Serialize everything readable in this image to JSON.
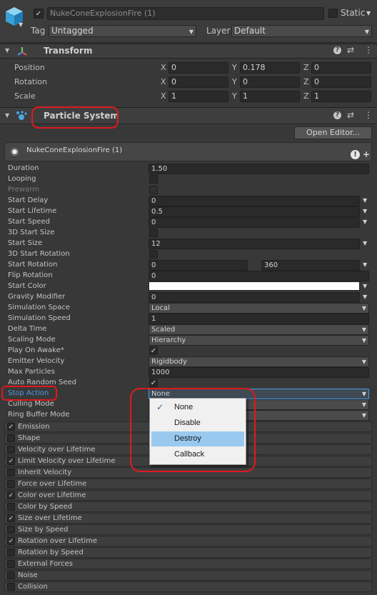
{
  "header": {
    "object_name": "NukeConeExplosionFire (1)",
    "static_label": "Static",
    "tag_label": "Tag",
    "tag_value": "Untagged",
    "layer_label": "Layer",
    "layer_value": "Default"
  },
  "transform": {
    "title": "Transform",
    "rows": [
      {
        "label": "Position",
        "x": "0",
        "y": "0.178",
        "z": "0"
      },
      {
        "label": "Rotation",
        "x": "0",
        "y": "0",
        "z": "0"
      },
      {
        "label": "Scale",
        "x": "1",
        "y": "1",
        "z": "1"
      }
    ],
    "axis_x": "X",
    "axis_y": "Y",
    "axis_z": "Z"
  },
  "particle_system": {
    "title": "Particle System",
    "open_editor_label": "Open Editor...",
    "main_module_title": "NukeConeExplosionFire (1)"
  },
  "props": {
    "duration": {
      "label": "Duration",
      "value": "1.50"
    },
    "looping": {
      "label": "Looping"
    },
    "prewarm": {
      "label": "Prewarm"
    },
    "start_delay": {
      "label": "Start Delay",
      "value": "0"
    },
    "start_lifetime": {
      "label": "Start Lifetime",
      "value": "0.5"
    },
    "start_speed": {
      "label": "Start Speed",
      "value": "0"
    },
    "start_size_3d": {
      "label": "3D Start Size"
    },
    "start_size": {
      "label": "Start Size",
      "value": "12"
    },
    "start_rotation_3d": {
      "label": "3D Start Rotation"
    },
    "start_rotation": {
      "label": "Start Rotation",
      "min": "0",
      "max": "360"
    },
    "flip_rotation": {
      "label": "Flip Rotation",
      "value": "0"
    },
    "start_color": {
      "label": "Start Color",
      "color": "#ffffff"
    },
    "gravity_modifier": {
      "label": "Gravity Modifier",
      "value": "0"
    },
    "simulation_space": {
      "label": "Simulation Space",
      "value": "Local"
    },
    "simulation_speed": {
      "label": "Simulation Speed",
      "value": "1"
    },
    "delta_time": {
      "label": "Delta Time",
      "value": "Scaled"
    },
    "scaling_mode": {
      "label": "Scaling Mode",
      "value": "Hierarchy"
    },
    "play_on_awake": {
      "label": "Play On Awake*"
    },
    "emitter_velocity": {
      "label": "Emitter Velocity",
      "value": "Rigidbody"
    },
    "max_particles": {
      "label": "Max Particles",
      "value": "1000"
    },
    "auto_random_seed": {
      "label": "Auto Random Seed"
    },
    "stop_action": {
      "label": "Stop Action",
      "value": "None"
    },
    "culling_mode": {
      "label": "Culling Mode"
    },
    "ring_buffer_mode": {
      "label": "Ring Buffer Mode"
    }
  },
  "stop_action_menu": {
    "options": [
      "None",
      "Disable",
      "Destroy",
      "Callback"
    ],
    "selected": "None",
    "highlighted": "Destroy"
  },
  "modules": [
    {
      "label": "Emission",
      "enabled": true
    },
    {
      "label": "Shape",
      "enabled": false
    },
    {
      "label": "Velocity over Lifetime",
      "enabled": false
    },
    {
      "label": "Limit Velocity over Lifetime",
      "enabled": true
    },
    {
      "label": "Inherit Velocity",
      "enabled": false
    },
    {
      "label": "Force over Lifetime",
      "enabled": false
    },
    {
      "label": "Color over Lifetime",
      "enabled": true
    },
    {
      "label": "Color by Speed",
      "enabled": false
    },
    {
      "label": "Size over Lifetime",
      "enabled": true
    },
    {
      "label": "Size by Speed",
      "enabled": false
    },
    {
      "label": "Rotation over Lifetime",
      "enabled": true
    },
    {
      "label": "Rotation by Speed",
      "enabled": false
    },
    {
      "label": "External Forces",
      "enabled": false
    },
    {
      "label": "Noise",
      "enabled": false
    },
    {
      "label": "Collision",
      "enabled": false
    }
  ],
  "colors": {
    "accent_blue": "#4d9be6",
    "highlight": "#99c9ef",
    "annotation_red": "#e0191f"
  }
}
